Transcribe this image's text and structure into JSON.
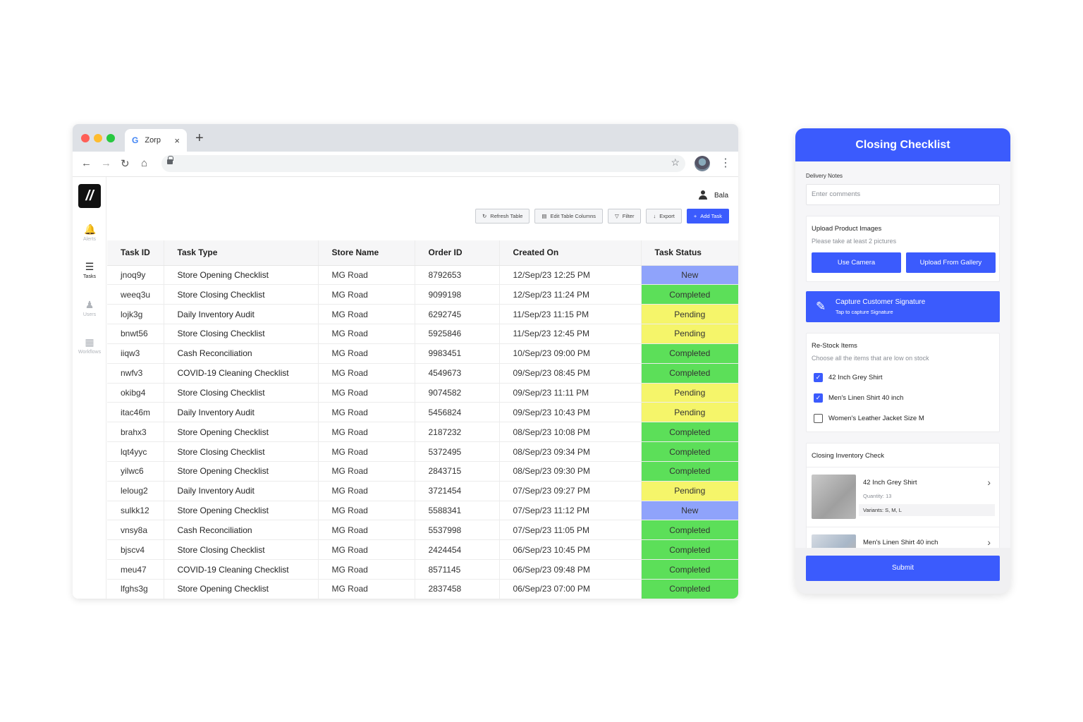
{
  "browser": {
    "tab_title": "Zorp",
    "tab_icon": "G",
    "new_tab": "+",
    "close_tab": "×"
  },
  "sidebar": {
    "logo": "//",
    "items": [
      {
        "label": "Alerts",
        "icon": "bell-icon"
      },
      {
        "label": "Tasks",
        "icon": "list-icon"
      },
      {
        "label": "Users",
        "icon": "users-icon"
      },
      {
        "label": "Workflows",
        "icon": "workflow-icon"
      }
    ]
  },
  "header": {
    "user_name": "Bala"
  },
  "toolbar": {
    "refresh": "Refresh Table",
    "edit_columns": "Edit Table Columns",
    "filter": "Filter",
    "export": "Export",
    "add_task": "Add Task"
  },
  "table": {
    "columns": [
      "Task ID",
      "Task Type",
      "Store Name",
      "Order ID",
      "Created On",
      "Task Status"
    ],
    "rows": [
      [
        "jnoq9y",
        "Store Opening Checklist",
        "MG Road",
        "8792653",
        "12/Sep/23 12:25 PM",
        "New"
      ],
      [
        "weeq3u",
        "Store Closing Checklist",
        "MG Road",
        "9099198",
        "12/Sep/23 11:24 PM",
        "Completed"
      ],
      [
        "lojk3g",
        "Daily Inventory Audit",
        "MG Road",
        "6292745",
        "11/Sep/23 11:15 PM",
        "Pending"
      ],
      [
        "bnwt56",
        "Store Closing Checklist",
        "MG Road",
        "5925846",
        "11/Sep/23 12:45 PM",
        "Pending"
      ],
      [
        "iiqw3",
        "Cash Reconciliation",
        "MG Road",
        "9983451",
        "10/Sep/23 09:00 PM",
        "Completed"
      ],
      [
        "nwfv3",
        "COVID-19 Cleaning Checklist",
        "MG Road",
        "4549673",
        "09/Sep/23 08:45 PM",
        "Completed"
      ],
      [
        "okibg4",
        "Store Closing Checklist",
        "MG Road",
        "9074582",
        "09/Sep/23 11:11 PM",
        "Pending"
      ],
      [
        "itac46m",
        "Daily Inventory Audit",
        "MG Road",
        "5456824",
        "09/Sep/23 10:43 PM",
        "Pending"
      ],
      [
        "brahx3",
        "Store Opening Checklist",
        "MG Road",
        "2187232",
        "08/Sep/23 10:08 PM",
        "Completed"
      ],
      [
        "lqt4yyc",
        "Store Closing Checklist",
        "MG Road",
        "5372495",
        "08/Sep/23 09:34 PM",
        "Completed"
      ],
      [
        "yilwc6",
        "Store Opening Checklist",
        "MG Road",
        "2843715",
        "08/Sep/23 09:30 PM",
        "Completed"
      ],
      [
        "leloug2",
        "Daily Inventory Audit",
        "MG Road",
        "3721454",
        "07/Sep/23 09:27 PM",
        "Pending"
      ],
      [
        "sulkk12",
        "Store Opening Checklist",
        "MG Road",
        "5588341",
        "07/Sep/23 11:12 PM",
        "New"
      ],
      [
        "vnsy8a",
        "Cash Reconciliation",
        "MG Road",
        "5537998",
        "07/Sep/23 11:05 PM",
        "Completed"
      ],
      [
        "bjscv4",
        "Store Closing Checklist",
        "MG Road",
        "2424454",
        "06/Sep/23 10:45 PM",
        "Completed"
      ],
      [
        "meu47",
        "COVID-19 Cleaning Checklist",
        "MG Road",
        "8571145",
        "06/Sep/23 09:48 PM",
        "Completed"
      ],
      [
        "lfghs3g",
        "Store Opening Checklist",
        "MG Road",
        "2837458",
        "06/Sep/23 07:00 PM",
        "Completed"
      ]
    ]
  },
  "status_colors": {
    "New": "#8fa3fb",
    "Completed": "#5cdf59",
    "Pending": "#f5f56a"
  },
  "mobile": {
    "title": "Closing Checklist",
    "delivery_notes_label": "Delivery Notes",
    "delivery_notes_placeholder": "Enter comments",
    "upload": {
      "title": "Upload Product Images",
      "subtitle": "Please take at least 2 pictures",
      "camera": "Use Camera",
      "gallery": "Upload From Gallery"
    },
    "signature": {
      "title": "Capture Customer Signature",
      "subtitle": "Tap to capture Signature"
    },
    "restock": {
      "title": "Re-Stock Items",
      "subtitle": "Choose all the items that are low on stock",
      "items": [
        {
          "label": "42 Inch Grey Shirt",
          "checked": true
        },
        {
          "label": "Men's Linen Shirt 40 inch",
          "checked": true
        },
        {
          "label": "Women's Leather Jacket Size M",
          "checked": false
        }
      ]
    },
    "inventory": {
      "title": "Closing Inventory Check",
      "products": [
        {
          "name": "42 Inch Grey Shirt",
          "quantity": "Quantity: 13",
          "variants": "Variants: S, M, L"
        },
        {
          "name": "Men's Linen Shirt 40 inch"
        }
      ]
    },
    "submit": "Submit"
  },
  "accent_color": "#3b5bfd"
}
